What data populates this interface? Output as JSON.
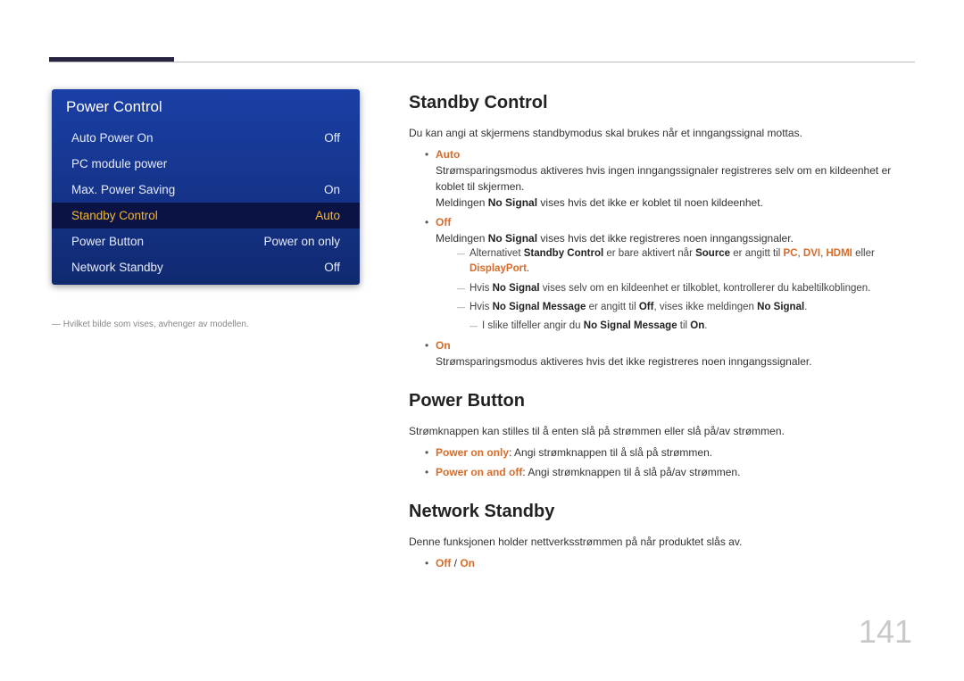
{
  "menu": {
    "title": "Power Control",
    "rows": [
      {
        "label": "Auto Power On",
        "value": "Off"
      },
      {
        "label": "PC module power",
        "value": ""
      },
      {
        "label": "Max. Power Saving",
        "value": "On"
      },
      {
        "label": "Standby Control",
        "value": "Auto"
      },
      {
        "label": "Power Button",
        "value": "Power on only"
      },
      {
        "label": "Network Standby",
        "value": "Off"
      }
    ],
    "footnote": "― Hvilket bilde som vises, avhenger av modellen."
  },
  "standby": {
    "title": "Standby Control",
    "intro": "Du kan angi at skjermens standbymodus skal brukes når et inngangssignal mottas.",
    "auto_label": "Auto",
    "auto_line1": "Strømsparingsmodus aktiveres hvis ingen inngangssignaler registreres selv om en kildeenhet er koblet til skjermen.",
    "auto_line2a": "Meldingen ",
    "auto_line2b": "No Signal",
    "auto_line2c": " vises hvis det ikke er koblet til noen kildeenhet.",
    "off_label": "Off",
    "off_line1a": "Meldingen ",
    "off_line1b": "No Signal",
    "off_line1c": " vises hvis det ikke registreres noen inngangssignaler.",
    "sub1_a": "Alternativet ",
    "sub1_b": "Standby Control",
    "sub1_c": " er bare aktivert når ",
    "sub1_d": "Source",
    "sub1_e": " er angitt til ",
    "sub1_f": "PC",
    "sub1_g": ", ",
    "sub1_h": "DVI",
    "sub1_i": ", ",
    "sub1_j": "HDMI",
    "sub1_k": " eller ",
    "sub1_l": "DisplayPort",
    "sub1_m": ".",
    "sub2_a": "Hvis ",
    "sub2_b": "No Signal",
    "sub2_c": " vises selv om en kildeenhet er tilkoblet, kontrollerer du kabeltilkoblingen.",
    "sub3_a": "Hvis ",
    "sub3_b": "No Signal Message",
    "sub3_c": " er angitt til ",
    "sub3_d": "Off",
    "sub3_e": ", vises ikke meldingen ",
    "sub3_f": "No Signal",
    "sub3_g": ".",
    "sub4_a": "I slike tilfeller angir du ",
    "sub4_b": "No Signal Message",
    "sub4_c": " til ",
    "sub4_d": "On",
    "sub4_e": ".",
    "on_label": "On",
    "on_line1": "Strømsparingsmodus aktiveres hvis det ikke registreres noen inngangssignaler."
  },
  "powerbtn": {
    "title": "Power Button",
    "intro": "Strømknappen kan stilles til å enten slå på strømmen eller slå på/av strømmen.",
    "opt1_a": "Power on only",
    "opt1_b": ": Angi strømknappen til å slå på strømmen.",
    "opt2_a": "Power on and off",
    "opt2_b": ": Angi strømknappen til å slå på/av strømmen."
  },
  "netstandby": {
    "title": "Network Standby",
    "intro": "Denne funksjonen holder nettverksstrømmen på når produktet slås av.",
    "opt_a": "Off",
    "opt_sep": " / ",
    "opt_b": "On"
  },
  "page_number": "141"
}
